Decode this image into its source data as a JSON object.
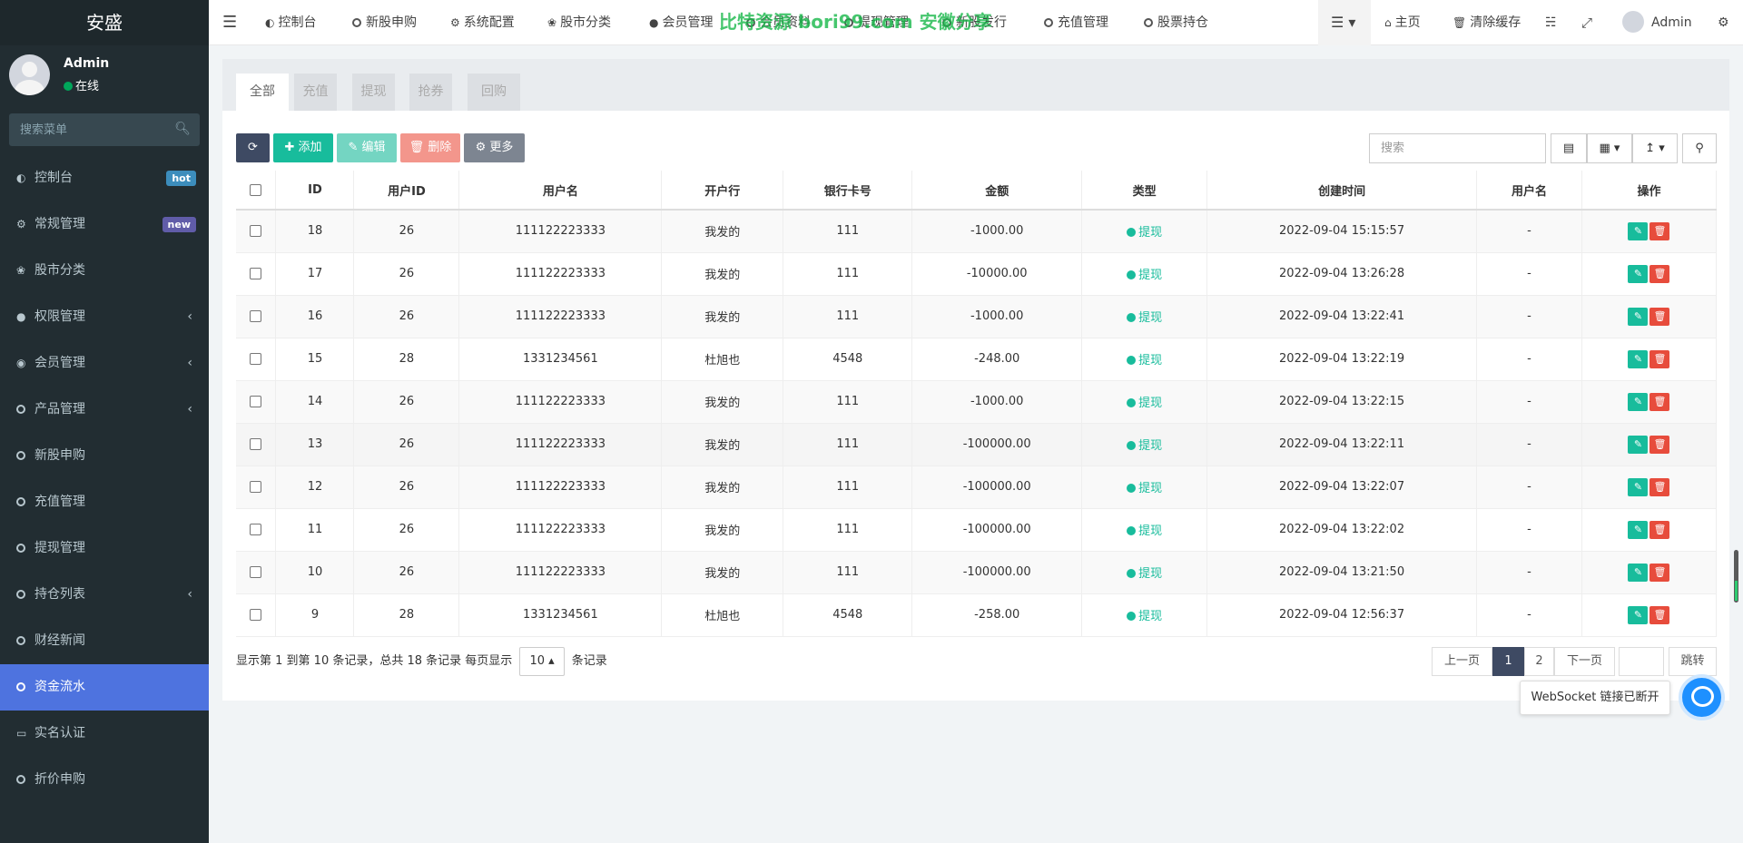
{
  "sidebar": {
    "brand": "安盛",
    "user_name": "Admin",
    "user_status": "在线",
    "search_placeholder": "搜索菜单",
    "items": [
      {
        "label": "控制台",
        "badge": "hot"
      },
      {
        "label": "常规管理",
        "badge": "new"
      },
      {
        "label": "股市分类"
      },
      {
        "label": "权限管理"
      },
      {
        "label": "会员管理"
      },
      {
        "label": "产品管理"
      },
      {
        "label": "新股申购"
      },
      {
        "label": "充值管理"
      },
      {
        "label": "提现管理"
      },
      {
        "label": "持仓列表"
      },
      {
        "label": "财经新闻"
      },
      {
        "label": "资金流水"
      },
      {
        "label": "实名认证"
      },
      {
        "label": "折价申购"
      }
    ]
  },
  "header": {
    "nav": [
      "控制台",
      "新股申购",
      "系统配置",
      "股市分类",
      "会员管理",
      "会员资料",
      "提现管理",
      "新股发行",
      "充值管理",
      "股票持仓"
    ],
    "watermark": "比特资源 bori99.com 安徽分享",
    "home": "主页",
    "clear_cache": "清除缓存",
    "admin": "Admin"
  },
  "tabs": [
    "全部",
    "充值",
    "提现",
    "抢券",
    "回购"
  ],
  "toolbar": {
    "add": "添加",
    "edit": "编辑",
    "delete": "删除",
    "more": "更多",
    "search_placeholder": "搜索"
  },
  "table": {
    "columns": [
      "ID",
      "用户ID",
      "用户名",
      "开户行",
      "银行卡号",
      "金额",
      "类型",
      "创建时间",
      "用户名",
      "操作"
    ],
    "rows": [
      {
        "id": "18",
        "uid": "26",
        "username": "111122223333",
        "bank": "我发的",
        "card": "111",
        "amount": "-1000.00",
        "type": "提现",
        "time": "2022-09-04 15:15:57",
        "user2": "-"
      },
      {
        "id": "17",
        "uid": "26",
        "username": "111122223333",
        "bank": "我发的",
        "card": "111",
        "amount": "-10000.00",
        "type": "提现",
        "time": "2022-09-04 13:26:28",
        "user2": "-"
      },
      {
        "id": "16",
        "uid": "26",
        "username": "111122223333",
        "bank": "我发的",
        "card": "111",
        "amount": "-1000.00",
        "type": "提现",
        "time": "2022-09-04 13:22:41",
        "user2": "-"
      },
      {
        "id": "15",
        "uid": "28",
        "username": "1331234561",
        "bank": "杜旭也",
        "card": "4548",
        "amount": "-248.00",
        "type": "提现",
        "time": "2022-09-04 13:22:19",
        "user2": "-"
      },
      {
        "id": "14",
        "uid": "26",
        "username": "111122223333",
        "bank": "我发的",
        "card": "111",
        "amount": "-1000.00",
        "type": "提现",
        "time": "2022-09-04 13:22:15",
        "user2": "-"
      },
      {
        "id": "13",
        "uid": "26",
        "username": "111122223333",
        "bank": "我发的",
        "card": "111",
        "amount": "-100000.00",
        "type": "提现",
        "time": "2022-09-04 13:22:11",
        "user2": "-"
      },
      {
        "id": "12",
        "uid": "26",
        "username": "111122223333",
        "bank": "我发的",
        "card": "111",
        "amount": "-100000.00",
        "type": "提现",
        "time": "2022-09-04 13:22:07",
        "user2": "-"
      },
      {
        "id": "11",
        "uid": "26",
        "username": "111122223333",
        "bank": "我发的",
        "card": "111",
        "amount": "-100000.00",
        "type": "提现",
        "time": "2022-09-04 13:22:02",
        "user2": "-"
      },
      {
        "id": "10",
        "uid": "26",
        "username": "111122223333",
        "bank": "我发的",
        "card": "111",
        "amount": "-100000.00",
        "type": "提现",
        "time": "2022-09-04 13:21:50",
        "user2": "-"
      },
      {
        "id": "9",
        "uid": "28",
        "username": "1331234561",
        "bank": "杜旭也",
        "card": "4548",
        "amount": "-258.00",
        "type": "提现",
        "time": "2022-09-04 12:56:37",
        "user2": "-"
      }
    ]
  },
  "pager": {
    "info_prefix": "显示第 1 到第 10 条记录，总共 18 条记录 每页显示",
    "page_size": "10",
    "info_suffix": "条记录",
    "prev": "上一页",
    "pages": [
      "1",
      "2"
    ],
    "next": "下一页",
    "jump": "跳转"
  },
  "websocket_tip": "WebSocket 链接已断开",
  "colors": {
    "sidebar": "#222d32",
    "active_menu": "#4e73df",
    "success": "#18bc9c",
    "danger": "#e74c3c"
  }
}
